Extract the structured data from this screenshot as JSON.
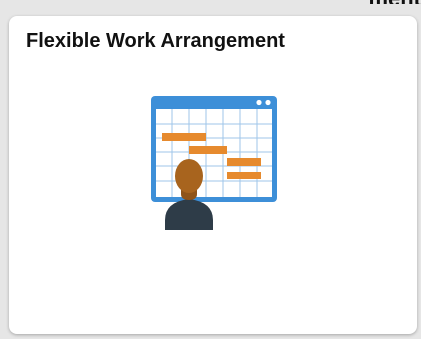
{
  "header": {
    "cutoff_text": "ment"
  },
  "tile": {
    "title": "Flexible Work Arrangement",
    "icon": "calendar-gantt-person-icon"
  },
  "colors": {
    "tile_background": "#ffffff",
    "page_background": "#e6e6e6",
    "calendar_blue": "#3d8fd8",
    "gantt_orange": "#e68a2e",
    "person_skin": "#a8641e",
    "person_body": "#2e3c48"
  }
}
